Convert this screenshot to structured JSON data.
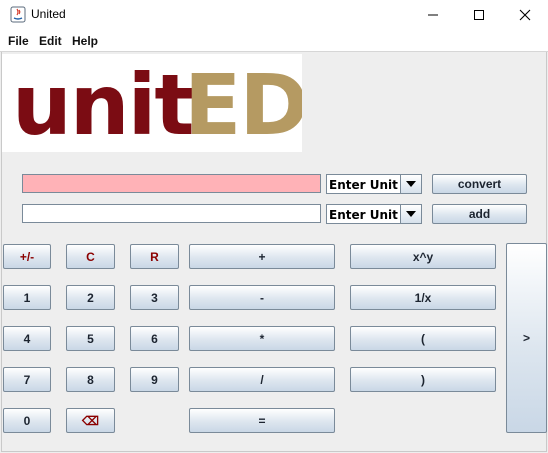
{
  "window": {
    "title": "United",
    "minimize_glyph": "—",
    "maximize_glyph": "☐",
    "close_glyph": "✕"
  },
  "menu": {
    "file": "File",
    "edit": "Edit",
    "help": "Help"
  },
  "logo": {
    "part1": "unit",
    "part2": "ED",
    "part1_color": "#7b0c13",
    "part2_color": "#b59a62"
  },
  "converter": {
    "input_value": "",
    "input_color": "#ffb2b7",
    "output_value": "",
    "unit_combo_1": "Enter Unit",
    "unit_combo_2": "Enter Unit",
    "convert_label": "convert",
    "add_label": "add"
  },
  "keypad": {
    "sign": "+/-",
    "clear": "C",
    "recall": "R",
    "plus": "+",
    "power": "x^y",
    "one": "1",
    "two": "2",
    "three": "3",
    "minus": "-",
    "reciprocal": "1/x",
    "four": "4",
    "five": "5",
    "six": "6",
    "multiply": "*",
    "open_paren": "(",
    "seven": "7",
    "eight": "8",
    "nine": "9",
    "divide": "/",
    "close_paren": ")",
    "zero": "0",
    "backspace": "⌫",
    "equals": "=",
    "expand": ">",
    "accent_color": "#8b0000"
  }
}
